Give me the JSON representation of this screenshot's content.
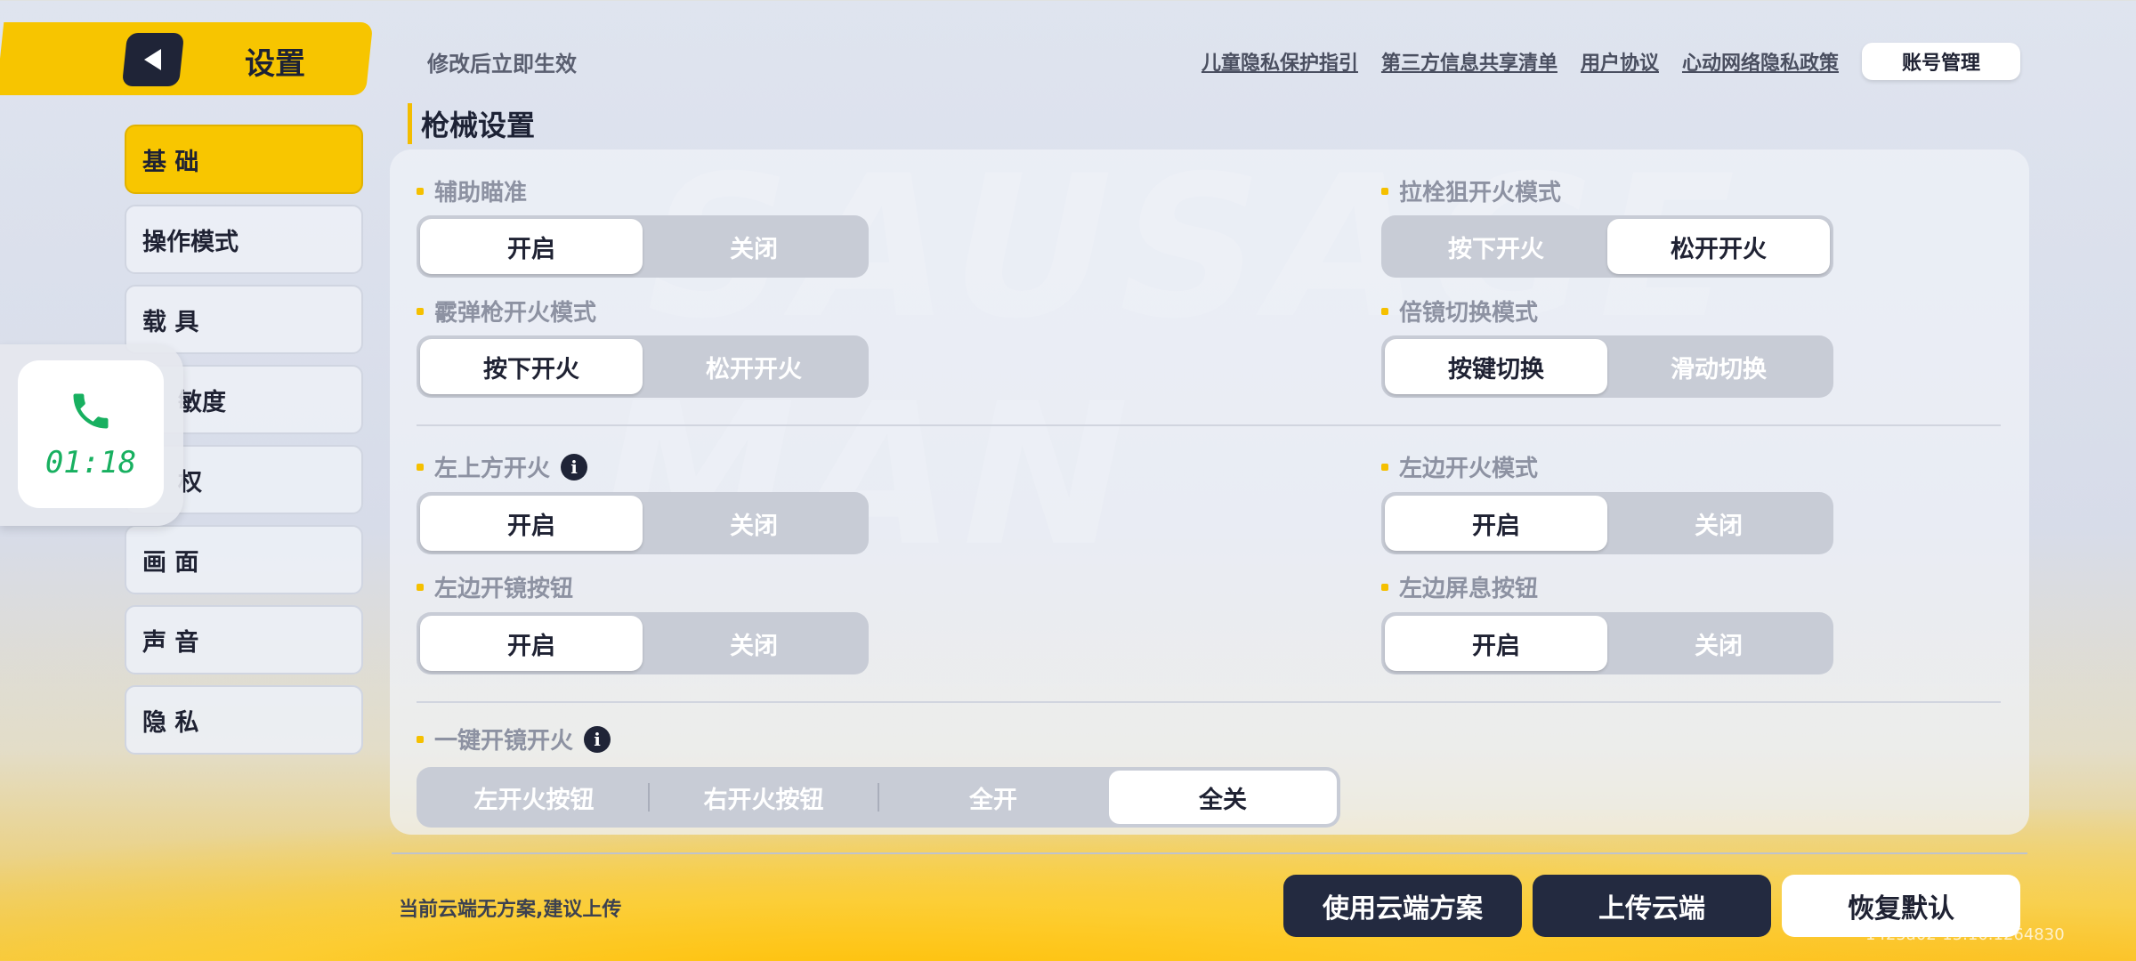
{
  "header": {
    "title": "设置",
    "subtitle": "修改后立即生效",
    "links": [
      "儿童隐私保护指引",
      "第三方信息共享清单",
      "用户协议",
      "心动网络隐私政策"
    ],
    "account_button": "账号管理"
  },
  "sidebar": {
    "items": [
      {
        "label": "基 础",
        "active": true
      },
      {
        "label": "操作模式",
        "active": false
      },
      {
        "label": "载 具",
        "active": false
      },
      {
        "label": "敏度",
        "active": false
      },
      {
        "label": "权",
        "active": false
      },
      {
        "label": "画 面",
        "active": false
      },
      {
        "label": "声 音",
        "active": false
      },
      {
        "label": "隐 私",
        "active": false
      }
    ]
  },
  "call": {
    "time": "01:18",
    "icon": "phone-icon"
  },
  "section": {
    "title": "枪械设置"
  },
  "settings": {
    "aim_assist": {
      "label": "辅助瞄准",
      "options": [
        "开启",
        "关闭"
      ],
      "selected": 0
    },
    "bolt_fire_mode": {
      "label": "拉栓狙开火模式",
      "options": [
        "按下开火",
        "松开开火"
      ],
      "selected": 1
    },
    "shotgun_fire_mode": {
      "label": "霰弹枪开火模式",
      "options": [
        "按下开火",
        "松开开火"
      ],
      "selected": 0
    },
    "scope_switch_mode": {
      "label": "倍镜切换模式",
      "options": [
        "按键切换",
        "滑动切换"
      ],
      "selected": 0
    },
    "top_left_fire": {
      "label": "左上方开火",
      "options": [
        "开启",
        "关闭"
      ],
      "selected": 0
    },
    "left_fire_mode": {
      "label": "左边开火模式",
      "options": [
        "开启",
        "关闭"
      ],
      "selected": 0
    },
    "left_scope_button": {
      "label": "左边开镜按钮",
      "options": [
        "开启",
        "关闭"
      ],
      "selected": 0
    },
    "left_breath_button": {
      "label": "左边屏息按钮",
      "options": [
        "开启",
        "关闭"
      ],
      "selected": 0
    },
    "one_key_scope_fire": {
      "label": "一键开镜开火",
      "options": [
        "左开火按钮",
        "右开火按钮",
        "全开",
        "全关"
      ],
      "selected": 3
    }
  },
  "footer": {
    "cloud_status": "当前云端无方案,建议上传",
    "use_cloud": "使用云端方案",
    "upload_cloud": "上传云端",
    "restore_default": "恢复默认",
    "uid": "1425a02-15.10.1264830"
  },
  "colors": {
    "accent": "#f7c500",
    "dark": "#232a40",
    "call_green": "#18b060"
  }
}
